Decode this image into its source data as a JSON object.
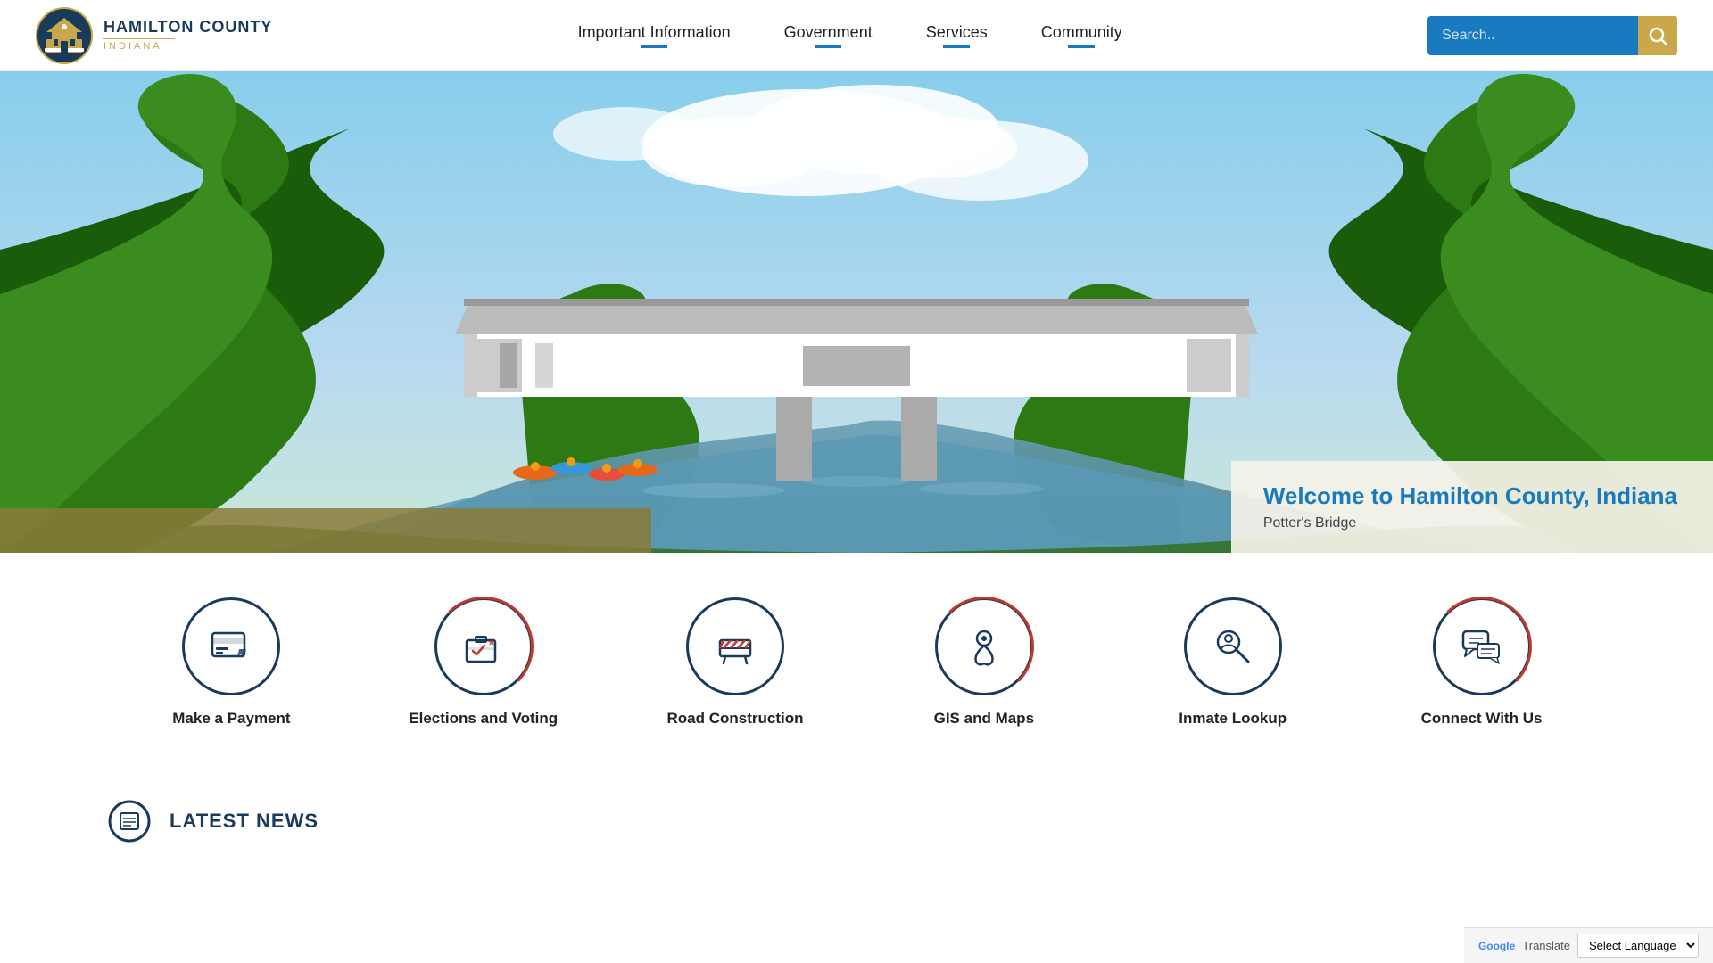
{
  "header": {
    "logo": {
      "name": "HAMILTON COUNTY",
      "state": "INDIANA"
    },
    "nav": {
      "items": [
        {
          "label": "Important Information",
          "id": "important-info"
        },
        {
          "label": "Government",
          "id": "government"
        },
        {
          "label": "Services",
          "id": "services"
        },
        {
          "label": "Community",
          "id": "community"
        }
      ]
    },
    "search": {
      "placeholder": "Search..",
      "button_label": "Search"
    }
  },
  "hero": {
    "welcome_title": "Welcome to Hamilton County, Indiana",
    "welcome_subtitle": "Potter's Bridge"
  },
  "quick_links": {
    "items": [
      {
        "label": "Make a Payment",
        "id": "make-payment",
        "icon": "payment"
      },
      {
        "label": "Elections and Voting",
        "id": "elections-voting",
        "icon": "voting"
      },
      {
        "label": "Road Construction",
        "id": "road-construction",
        "icon": "road"
      },
      {
        "label": "GIS and Maps",
        "id": "gis-maps",
        "icon": "map"
      },
      {
        "label": "Inmate Lookup",
        "id": "inmate-lookup",
        "icon": "inmate"
      },
      {
        "label": "Connect With Us",
        "id": "connect-us",
        "icon": "connect"
      }
    ]
  },
  "latest_news": {
    "label": "LATEST NEWS"
  },
  "translate": {
    "label": "Select Language",
    "google_text": "Google",
    "translate_text": "Translate"
  }
}
